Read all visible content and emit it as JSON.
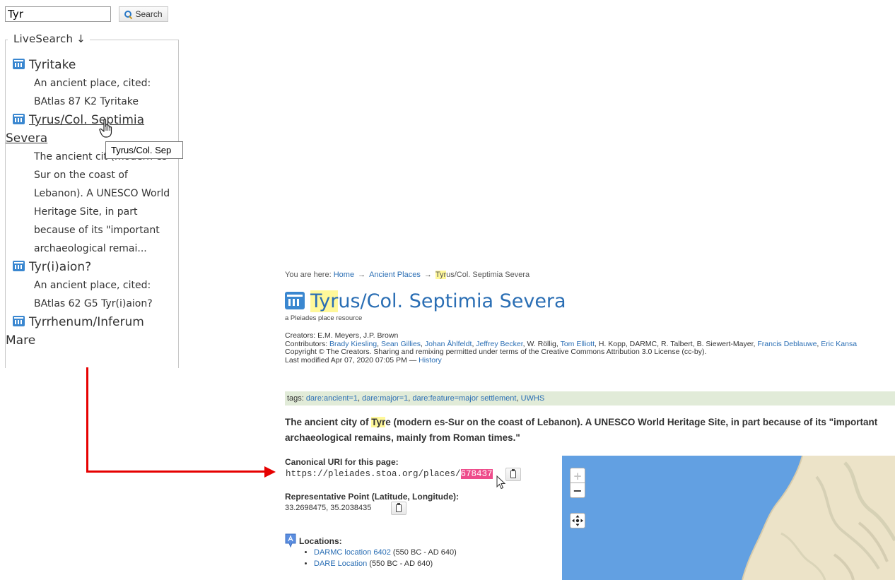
{
  "search": {
    "value": "Tyr",
    "button_label": "Search"
  },
  "live_search": {
    "legend": "LiveSearch ↓",
    "results": [
      {
        "title": "Tyritake",
        "description": "An ancient place, cited: BAtlas 87 K2 Tyritake"
      },
      {
        "title": "Tyrus/Col. Septimia Severa",
        "description": "The ancient cit (modern es-Sur on the coast of Lebanon). A UNESCO World Heritage Site, in part because of its \"important archaeological remai..."
      },
      {
        "title": "Tyr(i)aion?",
        "description": "An ancient place, cited: BAtlas 62 G5 Tyr(i)aion?"
      },
      {
        "title": "Tyrrhenum/Inferum Mare",
        "description": ""
      }
    ],
    "tooltip": "Tyrus/Col. Sep"
  },
  "breadcrumb": {
    "prefix": "You are here:",
    "home": "Home",
    "arrow": "→",
    "section": "Ancient Places",
    "current_hl": "Tyr",
    "current_rest": "us/Col. Septimia Severa"
  },
  "place": {
    "title_hl": "Tyr",
    "title_rest": "us/Col. Septimia Severa",
    "subtitle": "a Pleiades place resource",
    "creators_label": "Creators:",
    "creators": "E.M. Meyers, J.P. Brown",
    "contributors_label": "Contributors:",
    "contributors": [
      {
        "name": "Brady Kiesling",
        "link": true
      },
      {
        "name": "Sean Gillies",
        "link": true
      },
      {
        "name": "Johan Åhlfeldt",
        "link": true
      },
      {
        "name": "Jeffrey Becker",
        "link": true
      },
      {
        "name": "W. Röllig",
        "link": false
      },
      {
        "name": "Tom Elliott",
        "link": true
      },
      {
        "name": "H. Kopp",
        "link": false
      },
      {
        "name": "DARMC",
        "link": false
      },
      {
        "name": "R. Talbert",
        "link": false
      },
      {
        "name": "B. Siewert-Mayer",
        "link": false
      },
      {
        "name": "Francis Deblauwe",
        "link": true
      },
      {
        "name": "Eric Kansa",
        "link": true
      }
    ],
    "copyright": "Copyright © The Creators. Sharing and remixing permitted under terms of the Creative Commons Attribution 3.0 License (cc-by).",
    "last_modified": "Last modified Apr 07, 2020 07:05 PM —",
    "history_link": "History",
    "tags_label": "tags:",
    "tags": [
      "dare:ancient=1",
      "dare:major=1",
      "dare:feature=major settlement",
      "UWHS"
    ],
    "description_pre": "The ancient city of ",
    "description_hl": "Tyr",
    "description_post": "e (modern es-Sur on the coast of Lebanon). A UNESCO World Heritage Site, in part because of its \"important archaeological remains, mainly from Roman times.\"",
    "canonical_label": "Canonical URI for this page:",
    "canonical_uri_base": "https://pleiades.stoa.org/places/",
    "canonical_uri_id": "678437",
    "rep_point_label": "Representative Point (Latitude, Longitude):",
    "rep_point_value": "33.2698475, 35.2038435",
    "locations_label": "Locations:",
    "locations": [
      {
        "link": "DARMC location 6402",
        "range": " (550 BC - AD 640)"
      },
      {
        "link": "DARE Location",
        "range": " (550 BC - AD 640)"
      }
    ]
  },
  "map": {
    "zoom_in": "+",
    "zoom_out": "−",
    "water_color": "#62a0e2",
    "land_color": "#ece3c8"
  },
  "colors": {
    "accent": "#2a6eb4",
    "annotation_arrow": "#e60000",
    "highlight": "#fff89a",
    "selection": "#ee4c8b",
    "tags_bar": "#e1ebd8"
  }
}
